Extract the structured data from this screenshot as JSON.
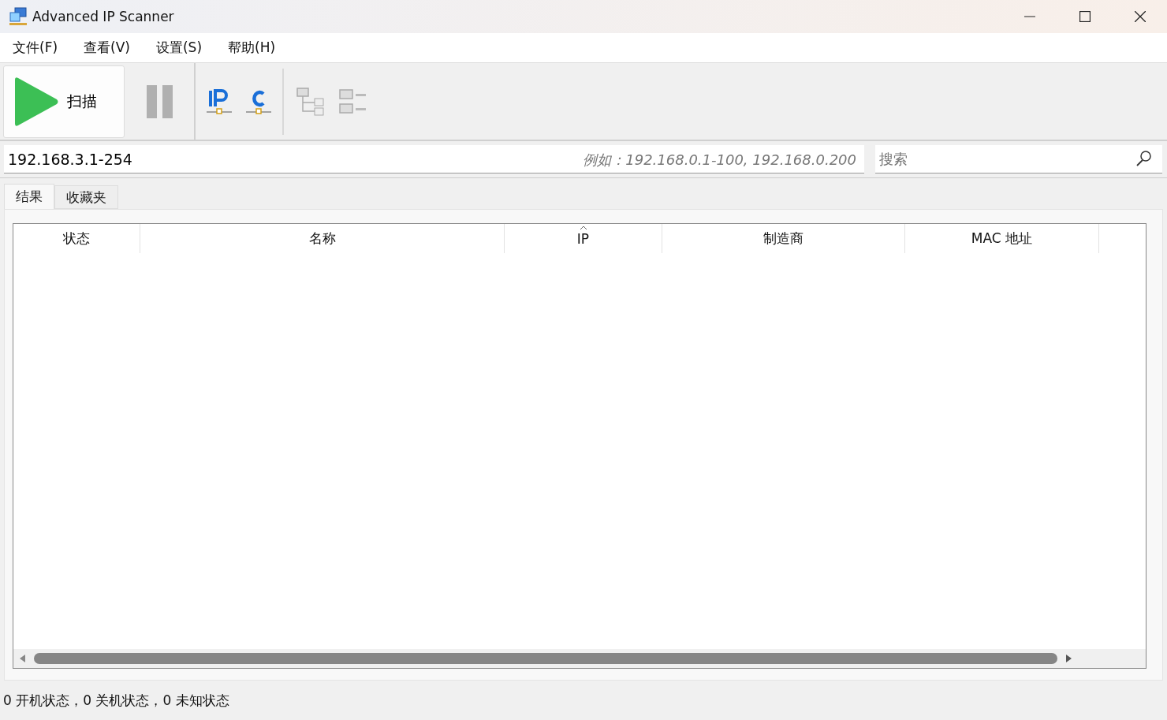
{
  "window": {
    "title": "Advanced IP Scanner"
  },
  "menu": [
    "文件(F)",
    "查看(V)",
    "设置(S)",
    "帮助(H)"
  ],
  "toolbar": {
    "scan_label": "扫描"
  },
  "address": {
    "value": "192.168.3.1-254",
    "hint": "例如：192.168.0.1-100, 192.168.0.200"
  },
  "search": {
    "placeholder": "搜索"
  },
  "tabs": [
    {
      "label": "结果",
      "selected": true
    },
    {
      "label": "收藏夹",
      "selected": false
    }
  ],
  "table": {
    "columns": [
      {
        "label": "状态",
        "sorted": false
      },
      {
        "label": "名称",
        "sorted": false
      },
      {
        "label": "IP",
        "sorted": true
      },
      {
        "label": "制造商",
        "sorted": false
      },
      {
        "label": "MAC 地址",
        "sorted": false
      }
    ]
  },
  "status_bar": "0 开机状态，0 关机状态，0 未知状态"
}
